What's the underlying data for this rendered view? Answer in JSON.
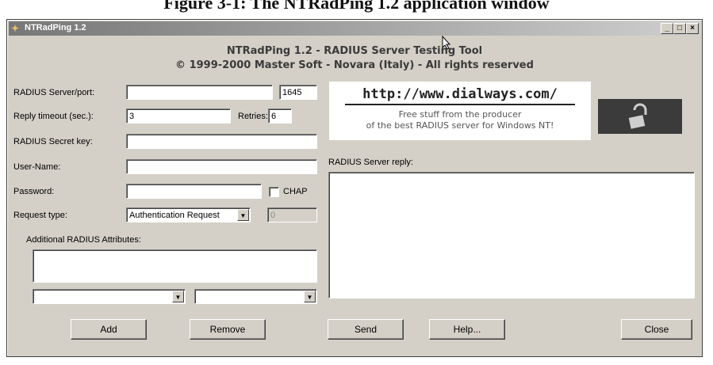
{
  "caption": "Figure 3-1: The NTRadPing 1.2 application window",
  "window": {
    "title": "NTRadPing 1.2",
    "header_line1": "NTRadPing 1.2 - RADIUS Server Testing Tool",
    "header_line2": "© 1999-2000 Master Soft - Novara (Italy) - All rights reserved"
  },
  "form": {
    "server_label": "RADIUS Server/port:",
    "server_value": "",
    "port_value": "1645",
    "timeout_label": "Reply timeout (sec.):",
    "timeout_value": "3",
    "retries_label": "Retries:",
    "retries_value": "6",
    "secret_label": "RADIUS Secret key:",
    "secret_value": "",
    "username_label": "User-Name:",
    "username_value": "",
    "password_label": "Password:",
    "password_value": "",
    "chap_label": "CHAP",
    "request_type_label": "Request type:",
    "request_type_value": "Authentication Request",
    "request_code_value": "0",
    "additional_label": "Additional RADIUS Attributes:"
  },
  "ad": {
    "url": "http://www.dialways.com/",
    "line1": "Free stuff from the producer",
    "line2": "of the best RADIUS server for Windows NT!"
  },
  "reply": {
    "label": "RADIUS Server reply:",
    "content": ""
  },
  "buttons": {
    "add": "Add",
    "remove": "Remove",
    "send": "Send",
    "help": "Help...",
    "close": "Close"
  },
  "titlebar_buttons": {
    "minimize": "_",
    "maximize": "□",
    "close": "×"
  }
}
